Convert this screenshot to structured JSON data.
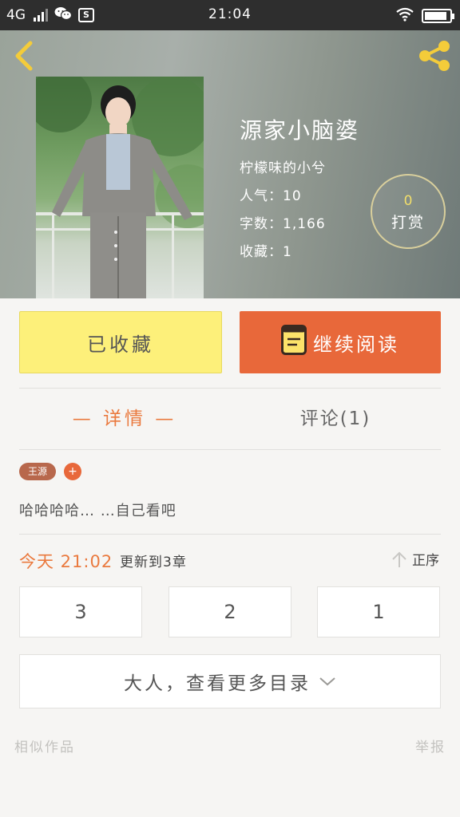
{
  "status_bar": {
    "network": "4G",
    "time": "21:04",
    "chat_icon": "wechat-icon",
    "app_icon": "S",
    "wifi_icon": "wifi-icon",
    "battery_level": 0.9
  },
  "header": {
    "back_icon": "chevron-left-icon",
    "share_icon": "share-icon",
    "title": "源家小脑婆",
    "author": "柠檬味的小兮",
    "popularity": "人气：10",
    "word_count": "字数：1,166",
    "favorites": "收藏：1",
    "reward_count": "0",
    "reward_label": "打赏"
  },
  "actions": {
    "favorited_label": "已收藏",
    "continue_label": "继续阅读",
    "continue_icon": "book-icon"
  },
  "tabs": {
    "detail": "— 详情 —",
    "comments": "评论(1)"
  },
  "tags": [
    "王源",
    "+"
  ],
  "description": "哈哈哈哈… …自己看吧",
  "update": {
    "time": "今天 21:02",
    "chapter": "更新到3章",
    "sort_label": "正序",
    "sort_icon": "arrow-up-icon"
  },
  "chapters": [
    "3",
    "2",
    "1"
  ],
  "more_catalog": "大人，查看更多目录",
  "footer": {
    "similar": "相似作品",
    "report": "举报"
  },
  "colors": {
    "accent": "#e8683a",
    "favorite_bg": "#fdf07a",
    "icon_yellow": "#f4cc3a"
  }
}
